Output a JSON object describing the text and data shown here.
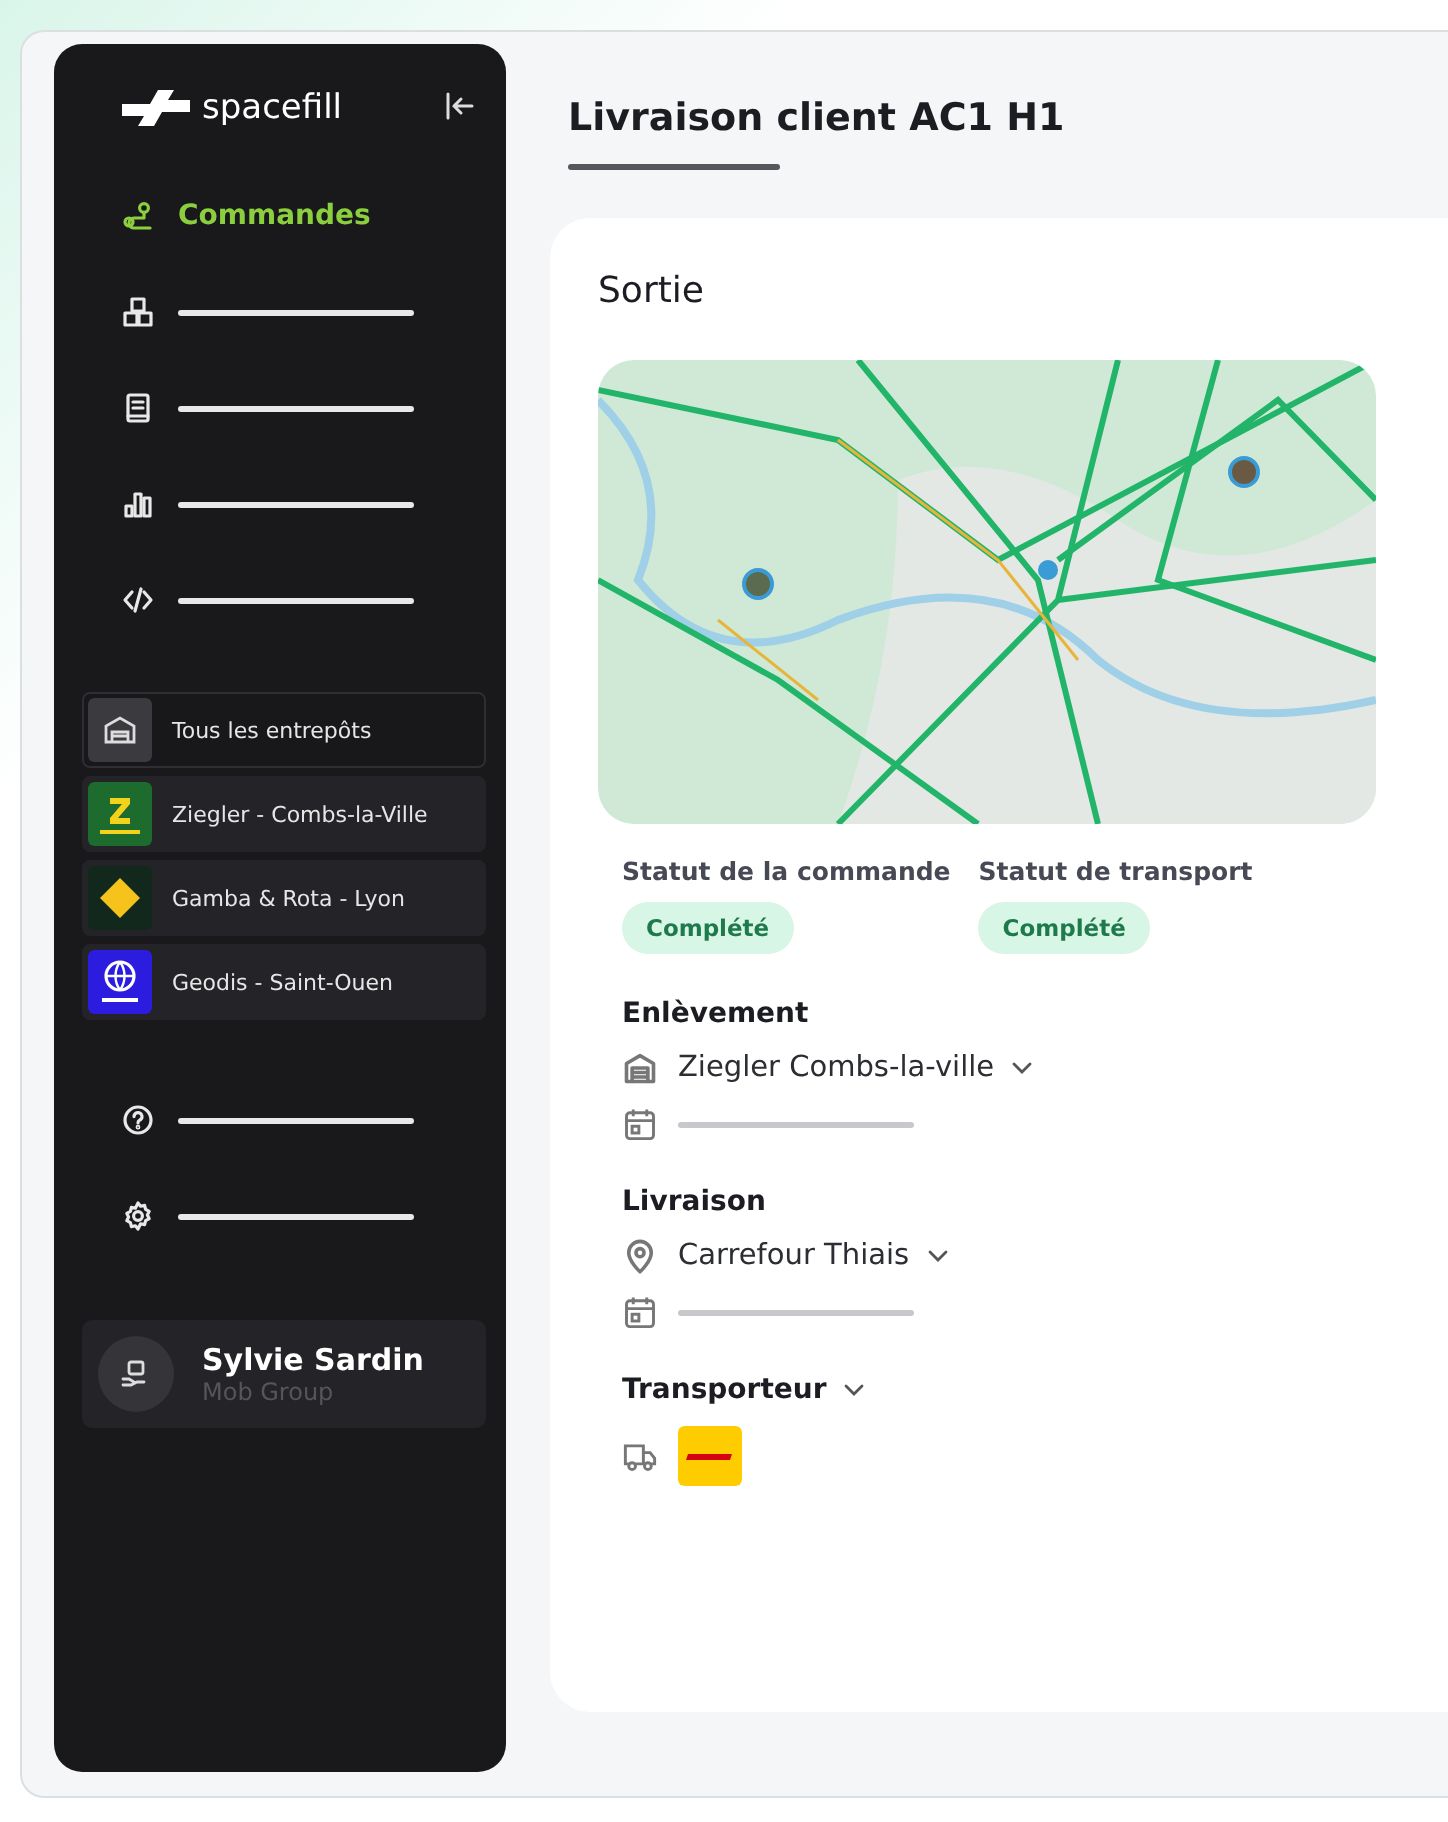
{
  "sidebar": {
    "brand": "spacefill",
    "nav": [
      {
        "kind": "label",
        "label": "Commandes",
        "selected": true
      },
      {
        "kind": "blank",
        "selected": false
      },
      {
        "kind": "blank",
        "selected": false
      },
      {
        "kind": "blank",
        "selected": false
      },
      {
        "kind": "blank",
        "selected": false
      }
    ],
    "warehouses": [
      {
        "label": "Tous les entrepôts",
        "selected": true
      },
      {
        "label": "Ziegler - Combs-la-Ville",
        "selected": false
      },
      {
        "label": "Gamba & Rota - Lyon",
        "selected": false
      },
      {
        "label": "Geodis - Saint-Ouen",
        "selected": false
      }
    ],
    "bottom_nav": [
      {
        "kind": "blank",
        "selected": false
      },
      {
        "kind": "blank",
        "selected": false
      }
    ],
    "user": {
      "name": "Sylvie Sardin",
      "organization": "Mob Group"
    }
  },
  "main": {
    "title": "Livraison client AC1 H1",
    "card": {
      "title": "Sortie",
      "statuses": [
        {
          "label": "Statut de la commande",
          "value": "Complété"
        },
        {
          "label": "Statut de transport",
          "value": "Complété"
        }
      ],
      "pickup": {
        "heading": "Enlèvement",
        "place": "Ziegler Combs-la-ville"
      },
      "delivery": {
        "heading": "Livraison",
        "place": "Carrefour Thiais"
      },
      "carrier": {
        "heading": "Transporteur"
      }
    }
  }
}
